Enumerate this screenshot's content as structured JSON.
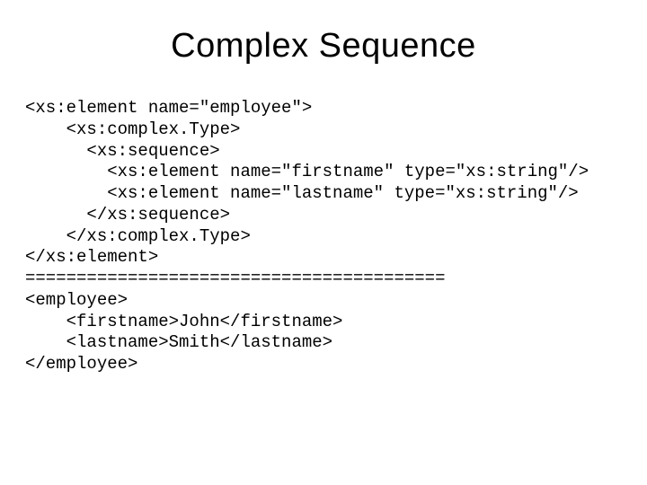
{
  "title": "Complex Sequence",
  "code": {
    "l1": "<xs:element name=\"employee\">",
    "l2": "    <xs:complex.Type>",
    "l3": "      <xs:sequence>",
    "l4": "        <xs:element name=\"firstname\" type=\"xs:string\"/>",
    "l5": "        <xs:element name=\"lastname\" type=\"xs:string\"/>",
    "l6": "      </xs:sequence>",
    "l7": "    </xs:complex.Type>",
    "l8": "</xs:element>",
    "l9": "=========================================",
    "l10": "<employee>",
    "l11": "    <firstname>John</firstname>",
    "l12": "    <lastname>Smith</lastname>",
    "l13": "</employee>"
  }
}
